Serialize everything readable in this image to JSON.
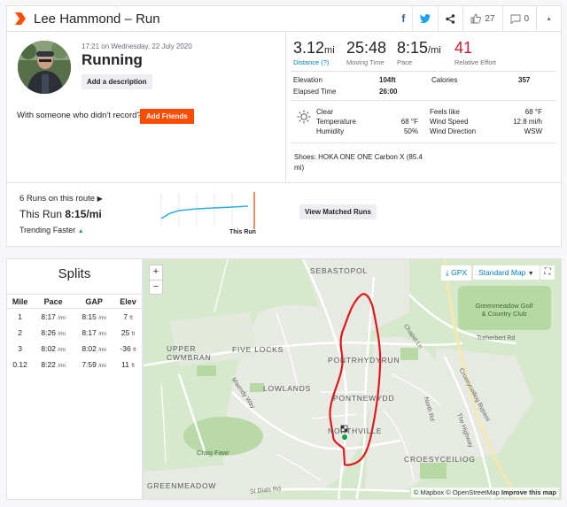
{
  "header": {
    "title": "Lee Hammond – Run",
    "kudos_count": "27",
    "comment_count": "0"
  },
  "activity": {
    "datetime": "17:21 on Wednesday, 22 July 2020",
    "name": "Running",
    "add_description": "Add a description",
    "someone_text": "With someone who didn't record?",
    "add_friends": "Add Friends"
  },
  "stats": {
    "distance": {
      "value": "3.12",
      "unit": "mi",
      "label": "Distance (?)"
    },
    "moving_time": {
      "value": "25:48",
      "label": "Moving Time"
    },
    "pace": {
      "value": "8:15",
      "unit": "/mi",
      "label": "Pace"
    },
    "relative_effort": {
      "value": "41",
      "label": "Relative Effort"
    }
  },
  "details": {
    "elevation_label": "Elevation",
    "elevation_value": "104ft",
    "calories_label": "Calories",
    "calories_value": "357",
    "elapsed_label": "Elapsed Time",
    "elapsed_value": "26:00"
  },
  "weather": {
    "condition": "Clear",
    "temperature_label": "Temperature",
    "temperature_value": "68 °F",
    "humidity_label": "Humidity",
    "humidity_value": "50%",
    "feels_like_label": "Feels like",
    "feels_like_value": "68 °F",
    "wind_speed_label": "Wind Speed",
    "wind_speed_value": "12.8 mi/h",
    "wind_direction_label": "Wind Direction",
    "wind_direction_value": "WSW"
  },
  "shoes": "Shoes: HOKA ONE ONE Carbon X (85.4 mi)",
  "route": {
    "runs_on_route": "6 Runs on this route",
    "this_run_label": "This Run",
    "this_run_pace": "8:15/mi",
    "trending": "Trending Faster",
    "this_run_marker": "This Run",
    "view_matched": "View Matched Runs"
  },
  "splits": {
    "title": "Splits",
    "headers": [
      "Mile",
      "Pace",
      "GAP",
      "Elev"
    ],
    "rows": [
      {
        "mile": "1",
        "pace": "8:17",
        "gap": "8:15",
        "elev": "7"
      },
      {
        "mile": "2",
        "pace": "8:26",
        "gap": "8:17",
        "elev": "25"
      },
      {
        "mile": "3",
        "pace": "8:02",
        "gap": "8:02",
        "elev": "-36"
      },
      {
        "mile": "0.12",
        "pace": "8:22",
        "gap": "7:59",
        "elev": "11"
      }
    ],
    "pace_unit": "/mi",
    "elev_unit": "ft"
  },
  "map": {
    "zoom_in": "+",
    "zoom_out": "−",
    "gpx": "GPX",
    "style": "Standard Map",
    "attribution": "© Mapbox © OpenStreetMap",
    "improve": "Improve this map",
    "labels": {
      "sebastopol": "SEBASTOPOL",
      "upper_cwmbran": "UPPER CWMBRAN",
      "five_locks": "FIVE LOCKS",
      "lowlands": "LOWLANDS",
      "pontrhydyrun": "PONTRHYDYRUN",
      "pontnewydd": "PONTNEWYDD",
      "northville": "NORTHVILLE",
      "croesyceiliog": "CROESYCEILIOG",
      "greenmeadow": "GREENMEADOW",
      "greenmeadow_golf": "Greenmeadow Golf & Country Club",
      "craig_fawr": "Craig Fawr",
      "treherbert_rd": "Treherbert Rd",
      "chapel_ln": "Chapel Ln",
      "croesyceiliog_bypass": "Croesyceiliog Bypass",
      "north_rd": "North Rd",
      "the_highway": "The Highway",
      "maendy_way": "Maendy Way",
      "st_dials_rd": "St Dials Rd"
    }
  },
  "colors": {
    "brand": "#fc4c02",
    "route": "#e3161c",
    "effort": "#c9192c",
    "link": "#007fb6",
    "spark": "#2bb0de"
  }
}
